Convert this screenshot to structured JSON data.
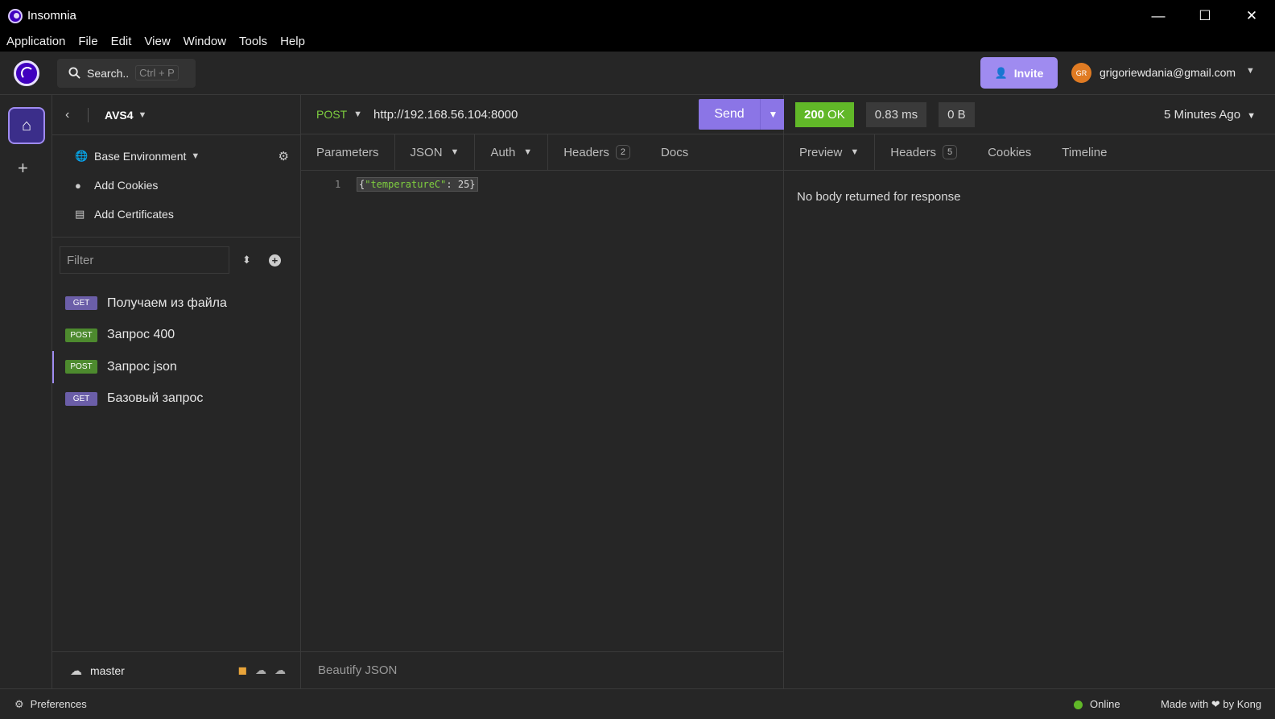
{
  "window": {
    "title": "Insomnia",
    "controls": {
      "minimize": "—",
      "maximize": "☐",
      "close": "✕"
    }
  },
  "menu": [
    "Application",
    "File",
    "Edit",
    "View",
    "Window",
    "Tools",
    "Help"
  ],
  "topbar": {
    "search_label": "Search..",
    "search_shortcut": "Ctrl + P",
    "invite_label": "Invite",
    "avatar_initials": "GR",
    "account_email": "grigoriewdania@gmail.com"
  },
  "workspace": {
    "name": "AVS4"
  },
  "environment": {
    "items": [
      {
        "label": "Base Environment",
        "icon": "globe-icon"
      },
      {
        "label": "Add Cookies",
        "icon": "cookie-icon"
      },
      {
        "label": "Add Certificates",
        "icon": "certificate-icon"
      }
    ]
  },
  "filter": {
    "placeholder": "Filter"
  },
  "requests": [
    {
      "method": "GET",
      "name": "Получаем из файла",
      "active": false
    },
    {
      "method": "POST",
      "name": "Запрос 400",
      "active": false
    },
    {
      "method": "POST",
      "name": "Запрос json",
      "active": true
    },
    {
      "method": "GET",
      "name": "Базовый запрос",
      "active": false
    }
  ],
  "sidebar_footer": {
    "branch": "master"
  },
  "request": {
    "method": "POST",
    "url": "http://192.168.56.104:8000",
    "send_label": "Send",
    "tabs": {
      "parameters": "Parameters",
      "body": "JSON",
      "auth": "Auth",
      "headers": "Headers",
      "headers_count": "2",
      "docs": "Docs"
    },
    "body": {
      "line_number": "1",
      "open": "{",
      "key": "\"temperatureC\"",
      "colon": ": ",
      "value": "25",
      "close": "}"
    },
    "footer_label": "Beautify JSON"
  },
  "response": {
    "status_code": "200",
    "status_text": "OK",
    "time": "0.83 ms",
    "size": "0 B",
    "when": "5 Minutes Ago",
    "tabs": {
      "preview": "Preview",
      "headers": "Headers",
      "headers_count": "5",
      "cookies": "Cookies",
      "timeline": "Timeline"
    },
    "empty_message": "No body returned for response"
  },
  "footer": {
    "preferences": "Preferences",
    "status": "Online",
    "made_with": "Made with ❤ by Kong"
  },
  "colors": {
    "accent": "#9f8bf0",
    "send": "#8b75e6",
    "ok": "#61b828",
    "post_badge": "#4d8a2e",
    "get_badge": "#6b5ea8",
    "panel": "#262626"
  }
}
